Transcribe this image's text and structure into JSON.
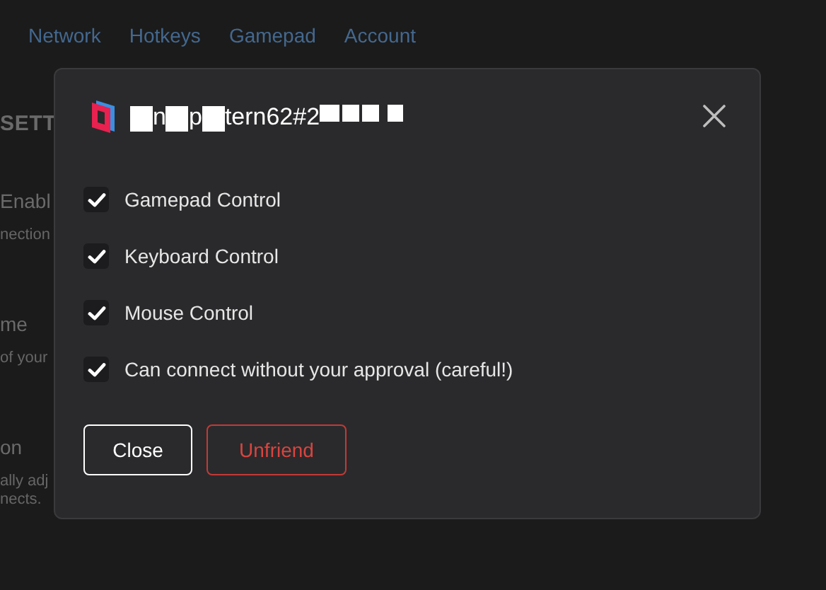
{
  "background": {
    "tabs": [
      "Network",
      "Hotkeys",
      "Gamepad",
      "Account"
    ],
    "texts": [
      {
        "kind": "heading",
        "text": "SETT"
      },
      {
        "kind": "label",
        "text": "Enabl"
      },
      {
        "kind": "hint",
        "text": "nection"
      },
      {
        "kind": "label",
        "text": "me"
      },
      {
        "kind": "hint",
        "text": "of your"
      },
      {
        "kind": "label",
        "text": "on"
      },
      {
        "kind": "hint",
        "text": "ally adj"
      },
      {
        "kind": "hint",
        "text": "nects."
      }
    ]
  },
  "dialog": {
    "title_parts": [
      "n",
      "p",
      "tern62#2"
    ],
    "options": [
      {
        "label": "Gamepad Control",
        "checked": true
      },
      {
        "label": "Keyboard Control",
        "checked": true
      },
      {
        "label": "Mouse Control",
        "checked": true
      },
      {
        "label": "Can connect without your approval (careful!)",
        "checked": true
      }
    ],
    "buttons": [
      {
        "label": "Close",
        "kind": "neutral"
      },
      {
        "label": "Unfriend",
        "kind": "danger"
      }
    ]
  }
}
